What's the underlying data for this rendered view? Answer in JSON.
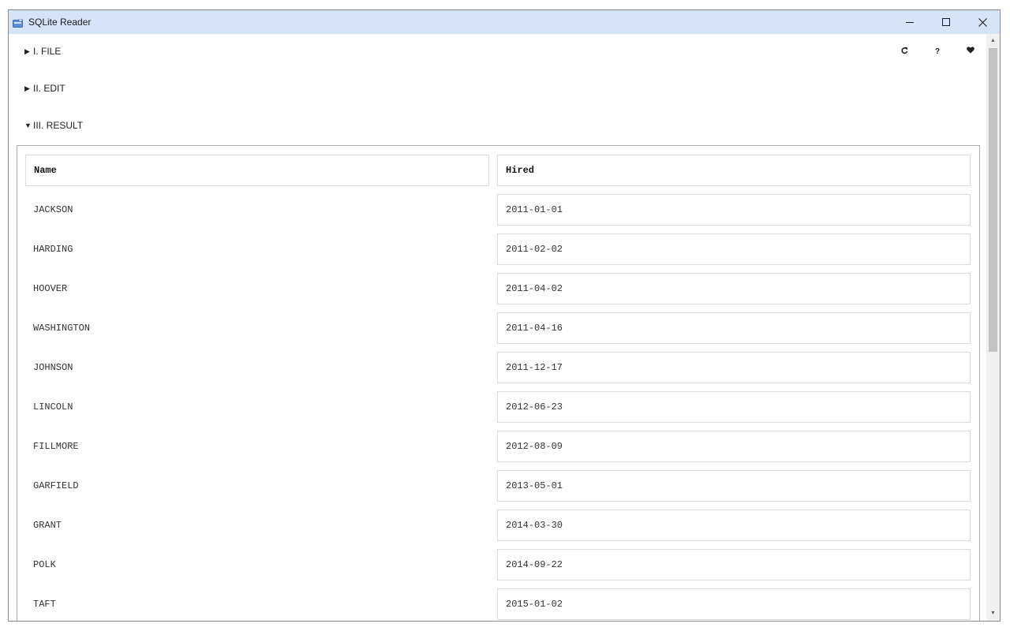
{
  "window": {
    "title": "SQLite Reader",
    "icon": "database-app-icon",
    "controls": [
      "minimize-icon",
      "maximize-icon",
      "close-icon"
    ]
  },
  "sections": {
    "file": {
      "label": "I. FILE",
      "expanded": false
    },
    "edit": {
      "label": "II. EDIT",
      "expanded": false
    },
    "result": {
      "label": "III. RESULT",
      "expanded": true
    }
  },
  "toolbar": {
    "refresh_icon": "refresh-icon",
    "help_label": "?",
    "favorite_icon": "heart-icon"
  },
  "result": {
    "columns": [
      "Name",
      "Hired"
    ],
    "rows": [
      [
        "JACKSON",
        "2011-01-01"
      ],
      [
        "HARDING",
        "2011-02-02"
      ],
      [
        "HOOVER",
        "2011-04-02"
      ],
      [
        "WASHINGTON",
        "2011-04-16"
      ],
      [
        "JOHNSON",
        "2011-12-17"
      ],
      [
        "LINCOLN",
        "2012-06-23"
      ],
      [
        "FILLMORE",
        "2012-08-09"
      ],
      [
        "GARFIELD",
        "2013-05-01"
      ],
      [
        "GRANT",
        "2014-03-30"
      ],
      [
        "POLK",
        "2014-09-22"
      ],
      [
        "TAFT",
        "2015-01-02"
      ]
    ]
  },
  "colors": {
    "titlebar": "#d6e4fa",
    "cell_border": "#dcdcdc",
    "panel_border": "#a9a9a9"
  }
}
